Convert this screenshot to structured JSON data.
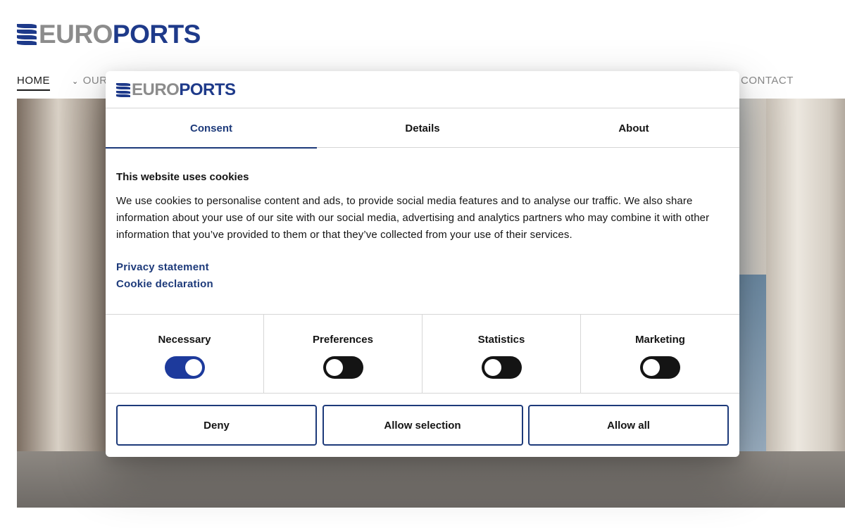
{
  "brand": {
    "euro": "EURO",
    "ports": "PORTS",
    "primary_color": "#1e3a8a",
    "gray_color": "#8c8c8c"
  },
  "nav": {
    "items": [
      {
        "label": "HOME",
        "active": true
      },
      {
        "label": "OUR",
        "has_dropdown": true
      },
      {
        "label": "CONTACT"
      }
    ]
  },
  "dialog": {
    "tabs": [
      {
        "label": "Consent",
        "active": true
      },
      {
        "label": "Details"
      },
      {
        "label": "About"
      }
    ],
    "heading": "This website uses cookies",
    "body": "We use cookies to personalise content and ads, to provide social media features and to analyse our traffic. We also share information about your use of our site with our social media, advertising and analytics partners who may combine it with other information that you’ve provided to them or that they’ve collected from your use of their services.",
    "links": [
      "Privacy statement",
      "Cookie declaration"
    ],
    "toggles": [
      {
        "label": "Necessary",
        "on": true
      },
      {
        "label": "Preferences",
        "on": false
      },
      {
        "label": "Statistics",
        "on": false
      },
      {
        "label": "Marketing",
        "on": false
      }
    ],
    "buttons": {
      "deny": "Deny",
      "allow_selection": "Allow selection",
      "allow_all": "Allow all"
    },
    "accent_color": "#1d3a7a"
  },
  "icons": {
    "scroll": "double-chevron-down-icon",
    "dropdown": "chevron-down-icon"
  }
}
